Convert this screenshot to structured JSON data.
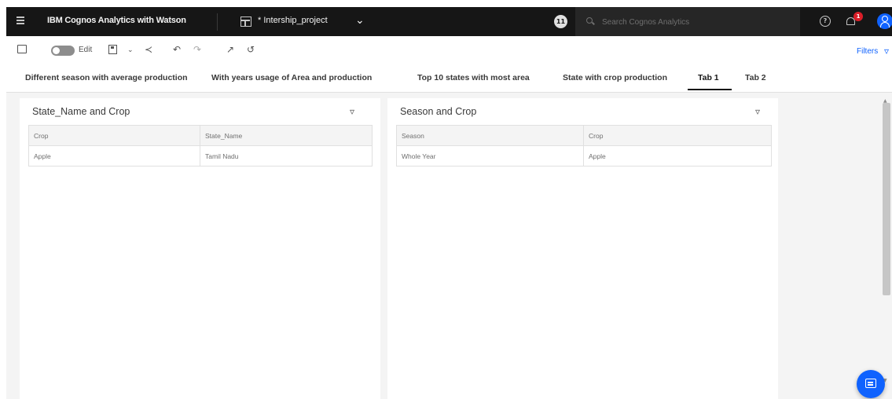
{
  "header": {
    "app_title": "IBM Cognos Analytics with Watson",
    "project_name": "* Intership_project",
    "notification_count": "11",
    "alert_badge": "1",
    "search_placeholder": "Search Cognos Analytics",
    "icons": [
      "menu-icon",
      "dashboard-icon",
      "chevron-down-icon",
      "search-icon",
      "help-icon",
      "bell-icon",
      "user-avatar-icon"
    ]
  },
  "toolbar": {
    "edit_label": "Edit",
    "filters_label": "Filters",
    "icons": [
      "comment-icon",
      "edit-toggle",
      "save-icon",
      "chevron-down-icon",
      "share-icon",
      "undo-icon",
      "redo-icon",
      "expand-icon",
      "reset-icon",
      "filter-icon"
    ]
  },
  "tabs": [
    {
      "label": "Different season with average production",
      "active": false
    },
    {
      "label": "With years usage of Area and production",
      "active": false
    },
    {
      "label": "Top 10 states with most area",
      "active": false
    },
    {
      "label": "State with crop production",
      "active": false
    },
    {
      "label": "Tab 1",
      "active": true
    },
    {
      "label": "Tab 2",
      "active": false
    }
  ],
  "widgets": {
    "left": {
      "title": "State_Name and Crop",
      "columns": [
        "Crop",
        "State_Name"
      ],
      "rows": [
        [
          "Apple",
          "Tamil Nadu"
        ]
      ]
    },
    "right": {
      "title": "Season and Crop",
      "columns": [
        "Season",
        "Crop"
      ],
      "rows": [
        [
          "Whole Year",
          "Apple"
        ]
      ]
    }
  },
  "colors": {
    "topbar": "#161616",
    "accent": "#0f62fe",
    "badge": "#da1e28",
    "canvas": "#f4f4f4"
  }
}
